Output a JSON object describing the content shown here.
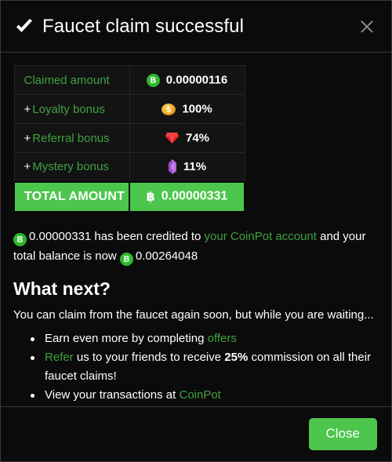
{
  "header": {
    "icon": "check-icon",
    "title": "Faucet claim successful",
    "close_icon": "close-icon"
  },
  "amounts": {
    "rows": [
      {
        "prefix": "",
        "label": "Claimed amount",
        "icon": "bitcoin-coin-icon",
        "value": "0.00000116"
      },
      {
        "prefix": "+",
        "label": "Loyalty bonus",
        "icon": "gold-coin-icon",
        "value": "100%"
      },
      {
        "prefix": "+",
        "label": "Referral bonus",
        "icon": "red-gem-icon",
        "value": "74%"
      },
      {
        "prefix": "+",
        "label": "Mystery bonus",
        "icon": "purple-gem-icon",
        "value": "11%"
      }
    ],
    "total": {
      "label": "TOTAL AMOUNT",
      "icon": "bitcoin-symbol-icon",
      "symbol": "฿",
      "value": "0.00000331"
    }
  },
  "credited": {
    "amount": "0.00000331",
    "text_1": " has been credited to ",
    "account_link": "your CoinPot account",
    "text_2": " and your total balance is now ",
    "balance": "0.00264048"
  },
  "what_next": {
    "heading": "What next?",
    "intro": "You can claim from the faucet again soon, but while you are waiting...",
    "items": [
      {
        "pre": "Earn even more by completing ",
        "link": "offers",
        "post": "",
        "bold": "",
        "tail": ""
      },
      {
        "pre": "",
        "link": "Refer",
        "post": " us to your friends to receive ",
        "bold": "25%",
        "tail": " commission on all their faucet claims!"
      },
      {
        "pre": "View your transactions at ",
        "link": "CoinPot",
        "post": "",
        "bold": "",
        "tail": ""
      }
    ]
  },
  "footer": {
    "close_label": "Close"
  },
  "colors": {
    "accent_green": "#4cc64c",
    "text_green": "#3fa13f",
    "background": "#0b0b0b",
    "cell_background": "#131313",
    "border": "#3a3a3a"
  }
}
